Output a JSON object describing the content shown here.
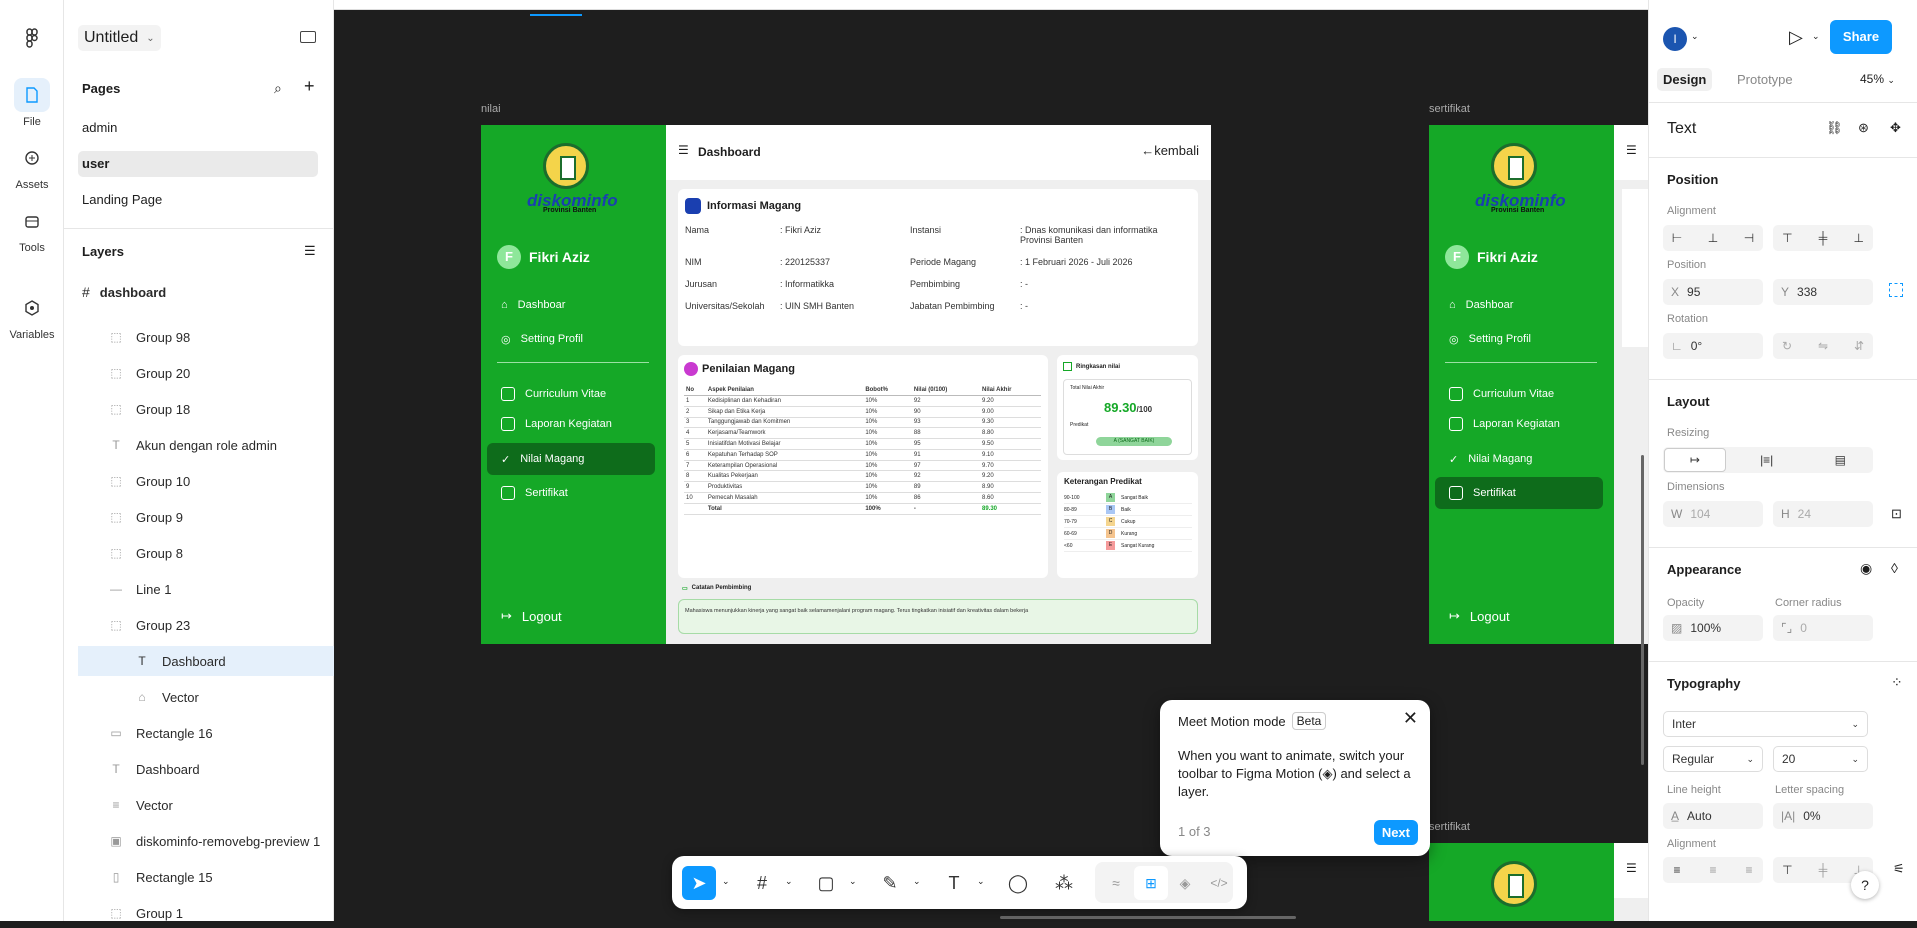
{
  "app": {
    "file_name": "Untitled",
    "rail": [
      "File",
      "Assets",
      "Tools",
      "Variables"
    ]
  },
  "pages": {
    "title": "Pages",
    "items": [
      "admin",
      "user",
      "Landing Page"
    ]
  },
  "layers": {
    "title": "Layers",
    "root": "dashboard",
    "items": [
      "Group 98",
      "Group 20",
      "Group 18",
      "Akun dengan role admin",
      "Group 10",
      "Group 9",
      "Group 8",
      "Line 1",
      "Group 23",
      "Dashboard",
      "Vector",
      "Rectangle 16",
      "Dashboard",
      "Vector",
      "diskominfo-removebg-preview 1",
      "Rectangle 15",
      "Group 1"
    ]
  },
  "canvas": {
    "label_nilai": "nilai",
    "label_sert": "sertifikat",
    "label_sert2": "sertifikat",
    "brand": "diskominfo",
    "brand2": "Provinsi Banten",
    "user_initial": "F",
    "user_name": "Fikri Aziz",
    "menu": [
      "Dashboar",
      "Setting Profil",
      "Curriculum Vitae",
      "Laporan Kegiatan",
      "Nilai Magang",
      "Sertifikat"
    ],
    "logout": "Logout",
    "header": "Dashboard",
    "back": "kembali",
    "info_title": "Informasi Magang",
    "info": [
      [
        "Nama",
        ": Fikri Aziz",
        "Instansi",
        ": Dnas komunikasi dan informatika Provinsi Banten"
      ],
      [
        "NIM",
        ": 220125337",
        "Periode Magang",
        ": 1 Februari 2026 - Juli 2026"
      ],
      [
        "Jurusan",
        ": Informatikka",
        "Pembimbing",
        ": -"
      ],
      [
        "Universitas/Sekolah",
        ": UIN SMH Banten",
        "Jabatan Pembimbing",
        ": -"
      ]
    ],
    "penilaian_title": "Penilaian Magang",
    "cols": [
      "No",
      "Aspek Penilaian",
      "Bobot%",
      "Nilai (0/100)",
      "Nilai Akhir"
    ],
    "rows": [
      [
        "1",
        "Kedisiplinan dan Kehadiran",
        "10%",
        "92",
        "9.20"
      ],
      [
        "2",
        "Sikap dan Etika Kerja",
        "10%",
        "90",
        "9.00"
      ],
      [
        "3",
        "Tanggungjawab dan Komitmen",
        "10%",
        "93",
        "9.30"
      ],
      [
        "4",
        "Kerjasama/Teamwork",
        "10%",
        "88",
        "8.80"
      ],
      [
        "5",
        "Inisiatifdan Motivasi Belajar",
        "10%",
        "95",
        "9.50"
      ],
      [
        "6",
        "Kepatuhan Terhadap SOP",
        "10%",
        "91",
        "9.10"
      ],
      [
        "7",
        "Keterampilan Operasional",
        "10%",
        "97",
        "9.70"
      ],
      [
        "8",
        "Kualitas Pekerjaan",
        "10%",
        "92",
        "9.20"
      ],
      [
        "9",
        "Produktivitas",
        "10%",
        "89",
        "8.90"
      ],
      [
        "10",
        "Pemecah Masalah",
        "10%",
        "86",
        "8.60"
      ],
      [
        "",
        "Total",
        "100%",
        "-",
        "89.30"
      ]
    ],
    "ringkasan_title": "Ringkasan nilai",
    "total_label": "Total Nilai Akhir",
    "total": "89.30",
    "total_suffix": "/100",
    "predikat_label": "Predikat",
    "predikat": "A (SANGAT BAIK)",
    "ket_title": "Keterangan Predikat",
    "ket": [
      [
        "90-100",
        "A",
        "Sangat Baik"
      ],
      [
        "80-89",
        "B",
        "Baik"
      ],
      [
        "70-79",
        "C",
        "Cukup"
      ],
      [
        "60-69",
        "D",
        "Kurang"
      ],
      [
        "<60",
        "E",
        "Sangat Kurang"
      ]
    ],
    "catatan_title": "Catatan Pembimbing",
    "catatan": "Mahasiswa menunjukkan kinerja yang sangat baik selamamenjalani program magang. Terus tingkatkan inisiatif dan kreativitas dalam bekerja"
  },
  "popup": {
    "title": "Meet Motion mode",
    "badge": "Beta",
    "body": "When you want to animate, switch your toolbar to Figma Motion (◈) and select a layer.",
    "step": "1 of 3",
    "next": "Next"
  },
  "right": {
    "avatar": "I",
    "share": "Share",
    "tabs": [
      "Design",
      "Prototype"
    ],
    "zoom": "45%",
    "section": "Text",
    "position": "Position",
    "alignment": "Alignment",
    "pos_label": "Position",
    "x": "95",
    "y": "338",
    "rotation_label": "Rotation",
    "rotation": "0°",
    "layout": "Layout",
    "resizing": "Resizing",
    "dimensions": "Dimensions",
    "w": "104",
    "h": "24",
    "appearance": "Appearance",
    "opacity_label": "Opacity",
    "opacity": "100%",
    "radius_label": "Corner radius",
    "radius": "0",
    "typography": "Typography",
    "font": "Inter",
    "weight": "Regular",
    "size": "20",
    "lh_label": "Line height",
    "lh": "Auto",
    "ls_label": "Letter spacing",
    "ls": "0%",
    "align_label": "Alignment"
  }
}
